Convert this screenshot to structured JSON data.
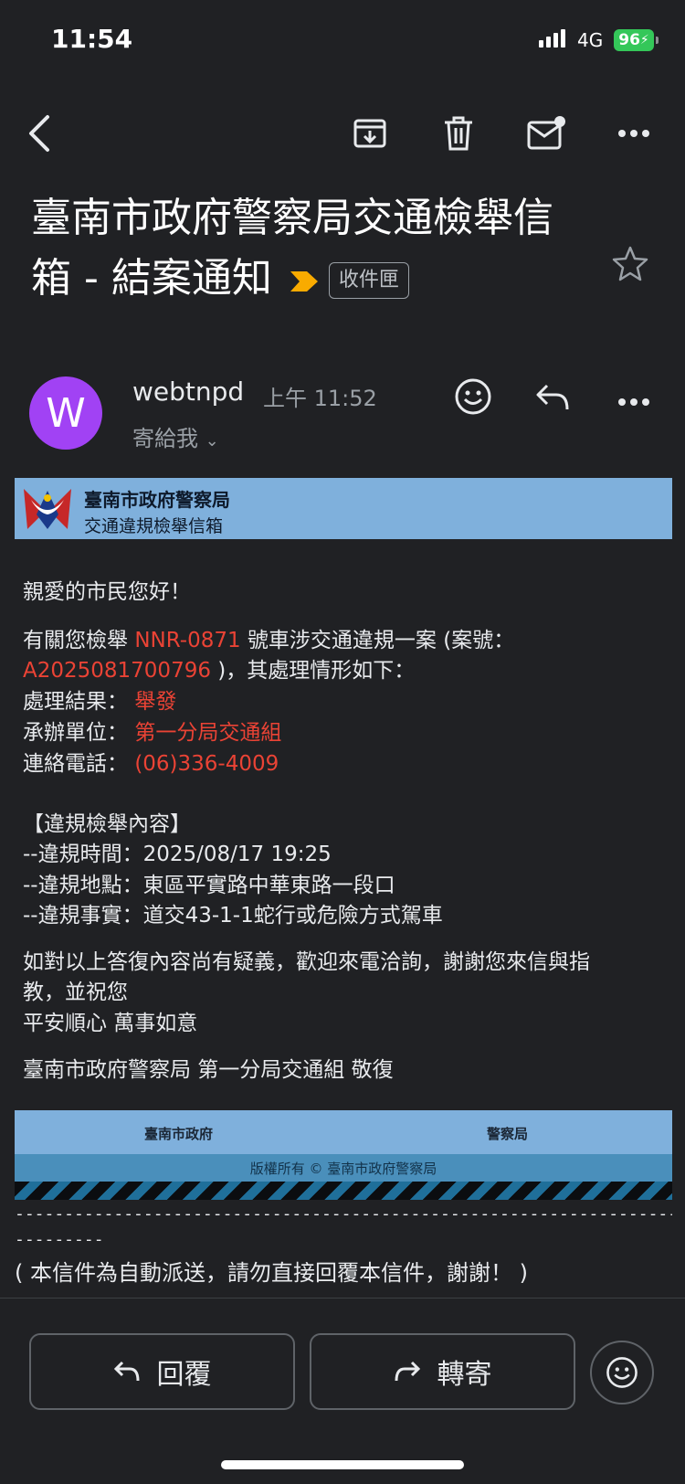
{
  "status_bar": {
    "time": "11:54",
    "network": "4G",
    "battery": "96"
  },
  "toolbar": {
    "back": "back",
    "archive": "archive",
    "delete": "delete",
    "mark_unread": "mark unread",
    "more": "more"
  },
  "subject": {
    "title": "臺南市政府警察局交通檢舉信箱 - 結案通知",
    "label_chip": "收件匣"
  },
  "sender": {
    "initial": "W",
    "name": "webtnpd",
    "time": "上午 11:52",
    "to": "寄給我"
  },
  "banner": {
    "org": "臺南市政府警察局",
    "subtitle": "交通違規檢舉信箱"
  },
  "body": {
    "greeting": "親愛的市民您好！",
    "intro_pre": "有關您檢舉 ",
    "plate": "NNR-0871",
    "intro_mid": " 號車涉交通違規一案 (案號：",
    "case_no": "A2025081700796",
    "intro_post": " )，其處理情形如下：",
    "result_label": "處理結果：",
    "result_value": "舉發",
    "unit_label": "承辦單位：",
    "unit_value": "第一分局交通組",
    "phone_label": "連絡電話：",
    "phone_value": "(06)336-4009",
    "section_title": "【違規檢舉內容】",
    "line_time": "--違規時間：2025/08/17 19:25",
    "line_place": "--違規地點：東區平實路中華東路一段口",
    "line_fact": "--違規事實：道交43-1-1蛇行或危險方式駕車",
    "closing_1": "如對以上答復內容尚有疑義，歡迎來電洽詢，謝謝您來信與指",
    "closing_2": "教，並祝您",
    "closing_3": "平安順心 萬事如意",
    "signature": "臺南市政府警察局 第一分局交通組 敬復"
  },
  "footer_banner": {
    "left": "臺南市政府",
    "right": "警察局",
    "copyright": "版權所有 © 臺南市政府警察局"
  },
  "separator_1": "-------------------------------------------------------------------------",
  "separator_2": "---------",
  "auto_notice": "( 本信件為自動派送，請勿直接回覆本信件，謝謝！ )",
  "actions": {
    "reply": "回覆",
    "forward": "轉寄"
  },
  "colors": {
    "background": "#202124",
    "accent_red": "#ea4335",
    "avatar": "#a142f4",
    "banner_blue": "#7fb0dc"
  }
}
